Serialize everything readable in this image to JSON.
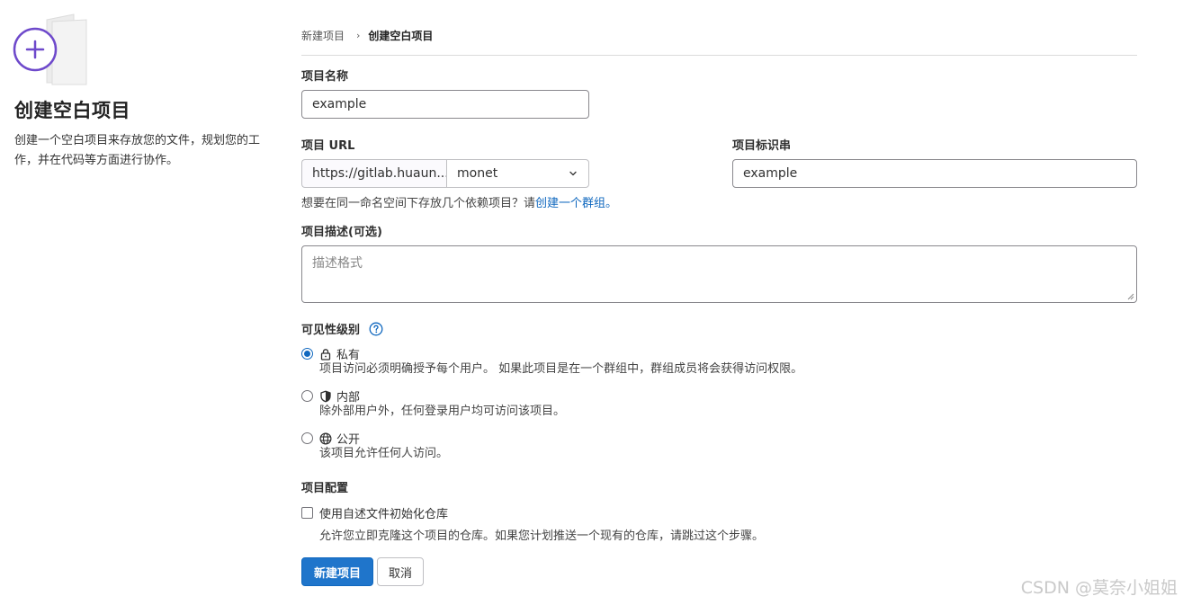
{
  "sidebar": {
    "title": "创建空白项目",
    "description": "创建一个空白项目来存放您的文件，规划您的工作，并在代码等方面进行协作。",
    "illustration_icon": "plus-circle-icon"
  },
  "breadcrumb": {
    "parent": "新建项目",
    "separator": "›",
    "current": "创建空白项目"
  },
  "form": {
    "project_name_label": "项目名称",
    "project_name_value": "example",
    "project_url_label": "项目 URL",
    "url_prefix": "https://gitlab.huaun...",
    "namespace_value": "monet",
    "project_slug_label": "项目标识串",
    "project_slug_value": "example",
    "group_hint_text": "想要在同一命名空间下存放几个依赖项目？请",
    "group_hint_link": "创建一个群组。",
    "description_label": "项目描述(可选)",
    "description_placeholder": "描述格式",
    "visibility_label": "可见性级别",
    "visibility_options": [
      {
        "title": "私有",
        "description": "项目访问必须明确授予每个用户。 如果此项目是在一个群组中，群组成员将会获得访问权限。",
        "icon": "lock-icon",
        "checked": true
      },
      {
        "title": "内部",
        "description": "除外部用户外，任何登录用户均可访问该项目。",
        "icon": "shield-icon",
        "checked": false
      },
      {
        "title": "公开",
        "description": "该项目允许任何人访问。",
        "icon": "earth-icon",
        "checked": false
      }
    ],
    "config_label": "项目配置",
    "readme_checkbox_label": "使用自述文件初始化仓库",
    "readme_checkbox_description": "允许您立即克隆这个项目的仓库。如果您计划推送一个现有的仓库，请跳过这个步骤。",
    "readme_checked": false
  },
  "actions": {
    "create_label": "新建项目",
    "cancel_label": "取消"
  },
  "watermark": "CSDN @莫奈小姐姐",
  "colors": {
    "primary": "#1f75cb",
    "link": "#1068bf",
    "accent_purple": "#6e49cb"
  }
}
